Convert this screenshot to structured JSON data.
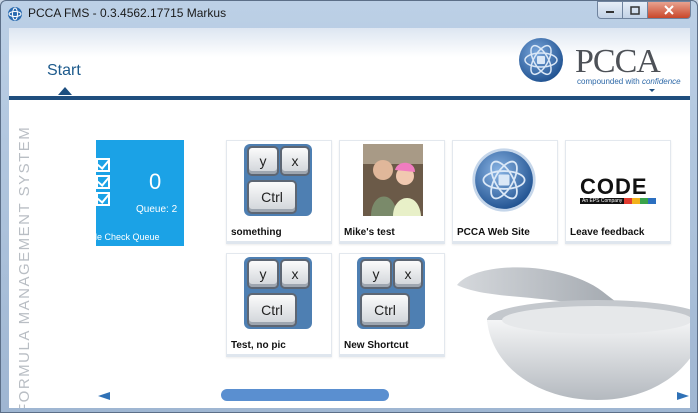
{
  "window": {
    "title": "PCCA FMS - 0.3.4562.17715 Markus"
  },
  "controls": {
    "minimize": "minimize-icon",
    "maximize": "maximize-icon",
    "close": "close-icon"
  },
  "header": {
    "start_label": "Start"
  },
  "logo": {
    "word": "PCCA",
    "tagline_prefix": "compounded with ",
    "tagline_emph": "confidence"
  },
  "side_caption": "FORMULA MANAGEMENT SYSTEM",
  "queue_tile": {
    "count": "0",
    "queue_label": "Queue: 2",
    "caption": "ple Check Queue"
  },
  "tiles": [
    {
      "label": "something",
      "icon": "keyboard-shortcut-icon"
    },
    {
      "label": "Mike's test",
      "icon": "photo"
    },
    {
      "label": "PCCA Web Site",
      "icon": "pcca-globe-icon"
    },
    {
      "label": "Leave feedback",
      "icon": "code-logo"
    },
    {
      "label": "Test, no pic",
      "icon": "keyboard-shortcut-icon"
    },
    {
      "label": "New Shortcut",
      "icon": "keyboard-shortcut-icon"
    }
  ],
  "keys": {
    "y": "y",
    "x": "x",
    "ctrl": "Ctrl"
  },
  "code_logo": {
    "word": "CODE",
    "sub": "An EPS Company"
  },
  "colors": {
    "accent_blue": "#1ba2e6",
    "header_line": "#1f4e7e",
    "scroll": "#5a8fd0"
  }
}
